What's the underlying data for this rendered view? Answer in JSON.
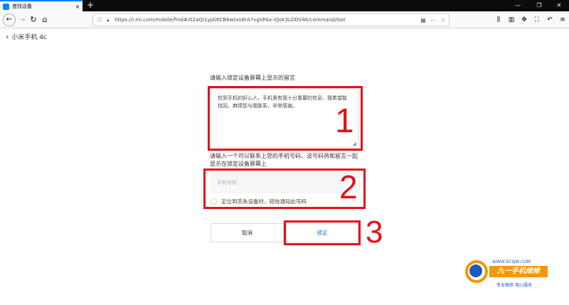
{
  "browser": {
    "tab_title": "查找设备",
    "tab_close": "×",
    "new_tab": "+",
    "url": "https://i.mi.com/mobile/find#/02aQI1yJAlKCB6wtao8rA7vgVPAx-lQok3LDDV4K/command/lost",
    "win_min": "—",
    "win_max": "❐",
    "win_close": "✕",
    "accent_color": "#0a84ff"
  },
  "page": {
    "back_icon": "chevron-left-icon",
    "title": "小米手机 4c",
    "message_label": "请输入锁定设备屏幕上显示的留言",
    "message_value": "捡到手机的好心人，手机里有我十分重要的信息，我希望能找回，麻烦您与我联系，非常感谢。",
    "phone_label": "请输入一个可以联系上您的手机号码，该号码将和留言一起显示在锁定设备屏幕上",
    "phone_placeholder": "手机号码",
    "notify_label": "定位到丢失设备时，短信通知此号码",
    "cancel_label": "取消",
    "lock_label": "锁定",
    "lock_color": "#1a73e8"
  },
  "annotations": {
    "step1": "1",
    "step2": "2",
    "step3": "3",
    "color": "#e3101b"
  },
  "watermark": {
    "url": "WWW.91SJW.COM",
    "brand": "九一手机维修",
    "tagline": "专业维修  用心服务"
  }
}
